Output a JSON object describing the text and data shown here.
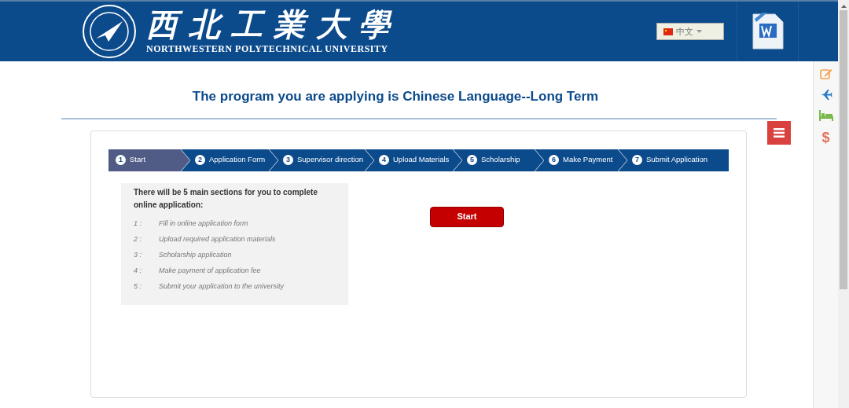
{
  "header": {
    "university_name_zh": "西北工業大學",
    "university_name_en": "NORTHWESTERN POLYTECHNICAL UNIVERSITY",
    "language": "中文"
  },
  "title": "The program you are applying is Chinese Language--Long Term",
  "steps": [
    {
      "number": "1",
      "label": "Start",
      "selected": true
    },
    {
      "number": "2",
      "label": "Application Form",
      "selected": false
    },
    {
      "number": "3",
      "label": "Supervisor direction",
      "selected": false
    },
    {
      "number": "4",
      "label": "Upload Materials",
      "selected": false
    },
    {
      "number": "5",
      "label": "Scholarship",
      "selected": false
    },
    {
      "number": "6",
      "label": "Make Payment",
      "selected": false
    },
    {
      "number": "7",
      "label": "Submit Application",
      "selected": false
    }
  ],
  "instructions": {
    "heading": "There will be 5 main sections for you to complete online application:",
    "items": [
      {
        "number": "1 :",
        "text": "Fill in online application form"
      },
      {
        "number": "2 :",
        "text": "Upload required application materials"
      },
      {
        "number": "3 :",
        "text": "Scholarship application"
      },
      {
        "number": "4 :",
        "text": "Make payment of application fee"
      },
      {
        "number": "5 :",
        "text": "Submit your application to the university"
      }
    ]
  },
  "start_button": "Start",
  "side_toolbar": {
    "dollar": "$"
  }
}
